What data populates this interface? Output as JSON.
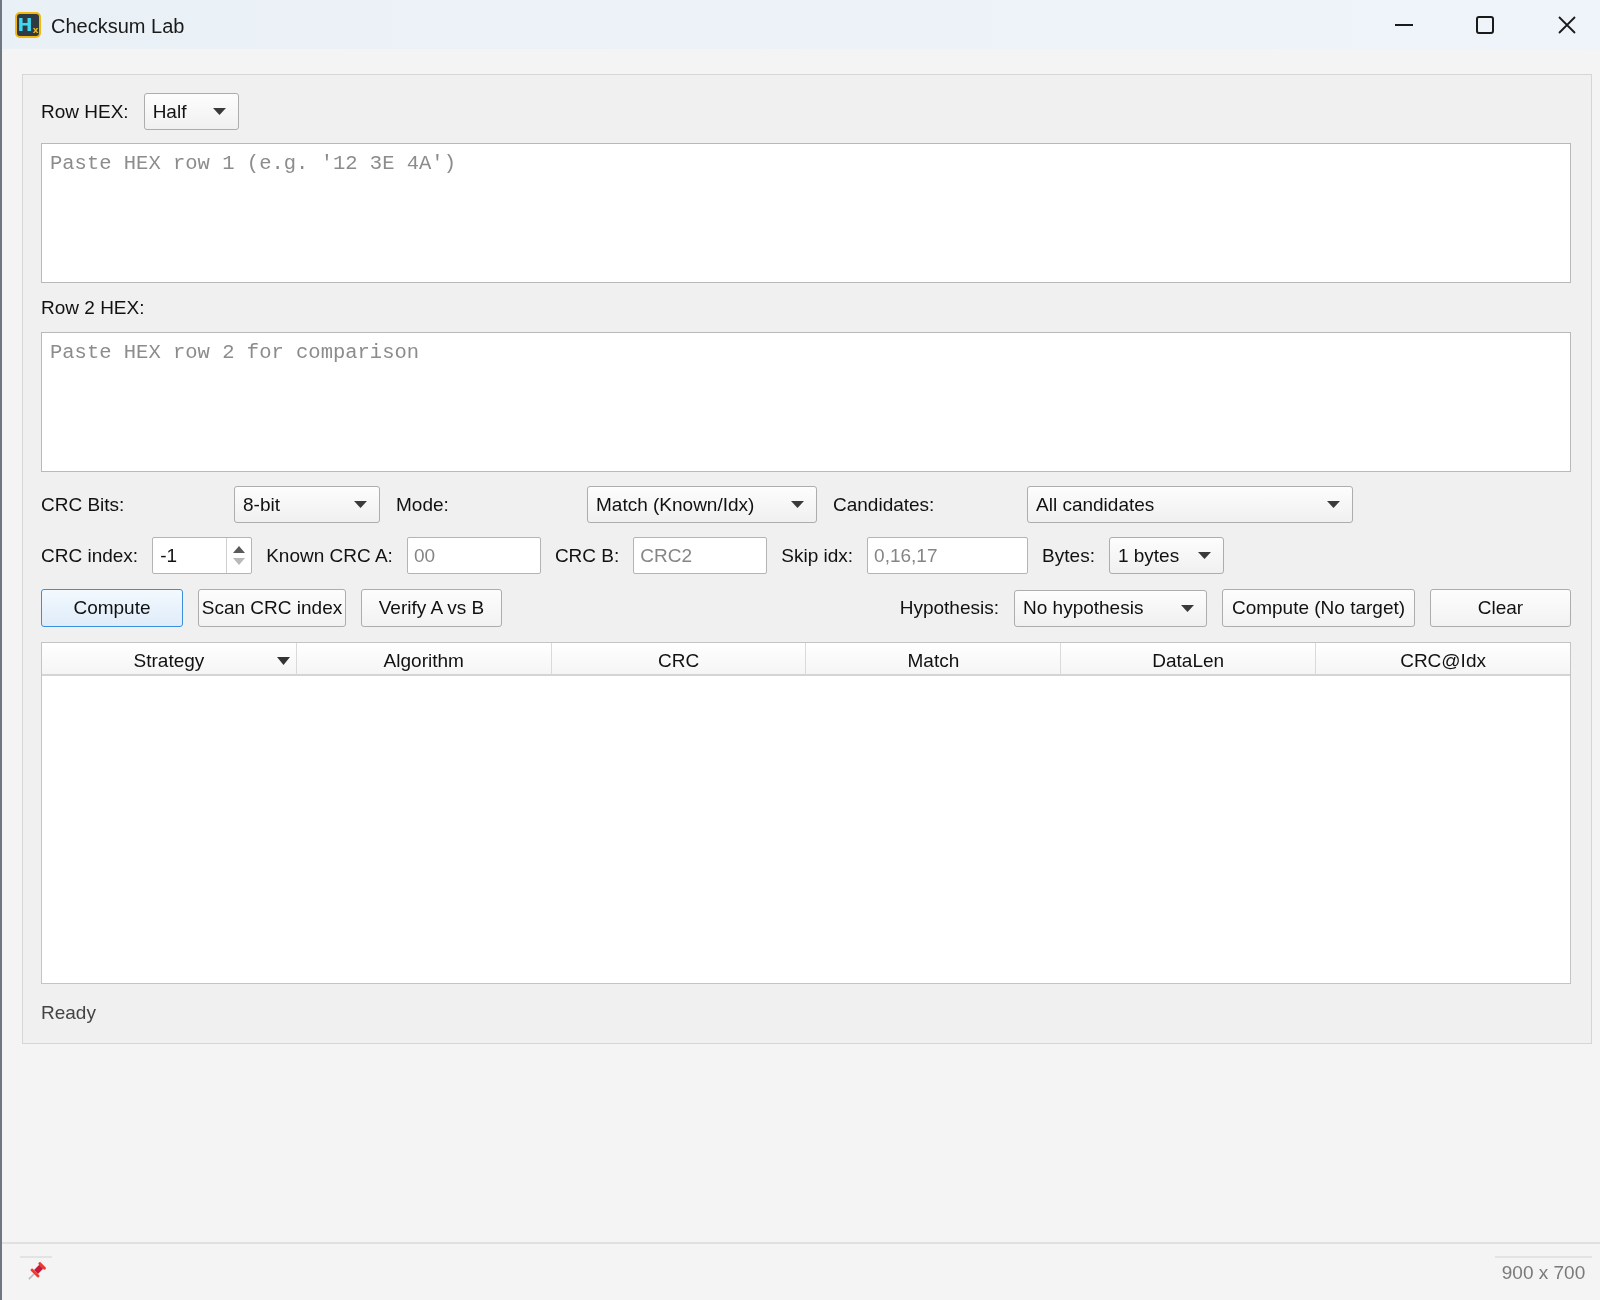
{
  "window": {
    "title": "Checksum Lab",
    "logo_text": "H$_{x}$"
  },
  "row_hex": {
    "label": "Row HEX:",
    "mode": {
      "value": "Half"
    },
    "placeholder": "Paste HEX row 1 (e.g. '12 3E 4A')"
  },
  "row2_hex": {
    "label": "Row 2 HEX:",
    "placeholder": "Paste HEX row 2 for comparison"
  },
  "settings": [
    {
      "kind": "combo",
      "label": "CRC Bits:",
      "value": "8-bit"
    },
    {
      "kind": "combo",
      "label": "Mode:",
      "value": "Match (Known/Idx)"
    },
    {
      "kind": "combo",
      "label": "Candidates:",
      "value": "All candidates"
    }
  ],
  "params": [
    {
      "kind": "spin",
      "label": "CRC index:",
      "value": "-1",
      "can_increase": true,
      "can_decrease": false
    },
    {
      "kind": "input",
      "label": "Known CRC A:",
      "placeholder": "00"
    },
    {
      "kind": "input",
      "label": "CRC B:",
      "placeholder": "CRC2"
    },
    {
      "kind": "input",
      "label": "Skip idx:",
      "placeholder": "0,16,17"
    },
    {
      "kind": "combo",
      "label": "Bytes:",
      "value": "1 bytes"
    }
  ],
  "actions": [
    {
      "label": "Compute",
      "default": true
    },
    {
      "label": "Scan CRC index",
      "default": false
    },
    {
      "label": "Verify A vs B",
      "default": false
    }
  ],
  "hypothesis": {
    "label": "Hypothesis:",
    "value": "No hypothesis"
  },
  "actions_right": [
    {
      "label": "Compute (No target)",
      "default": false
    },
    {
      "label": "Clear",
      "default": false
    }
  ],
  "table": {
    "columns": [
      {
        "label": "Strategy",
        "sorted": true
      },
      {
        "label": "Algorithm",
        "sorted": false
      },
      {
        "label": "CRC",
        "sorted": false
      },
      {
        "label": "Match",
        "sorted": false
      },
      {
        "label": "DataLen",
        "sorted": false
      },
      {
        "label": "CRC@Idx",
        "sorted": false
      }
    ]
  },
  "status": "Ready",
  "footer": {
    "size": "900 x 700"
  }
}
